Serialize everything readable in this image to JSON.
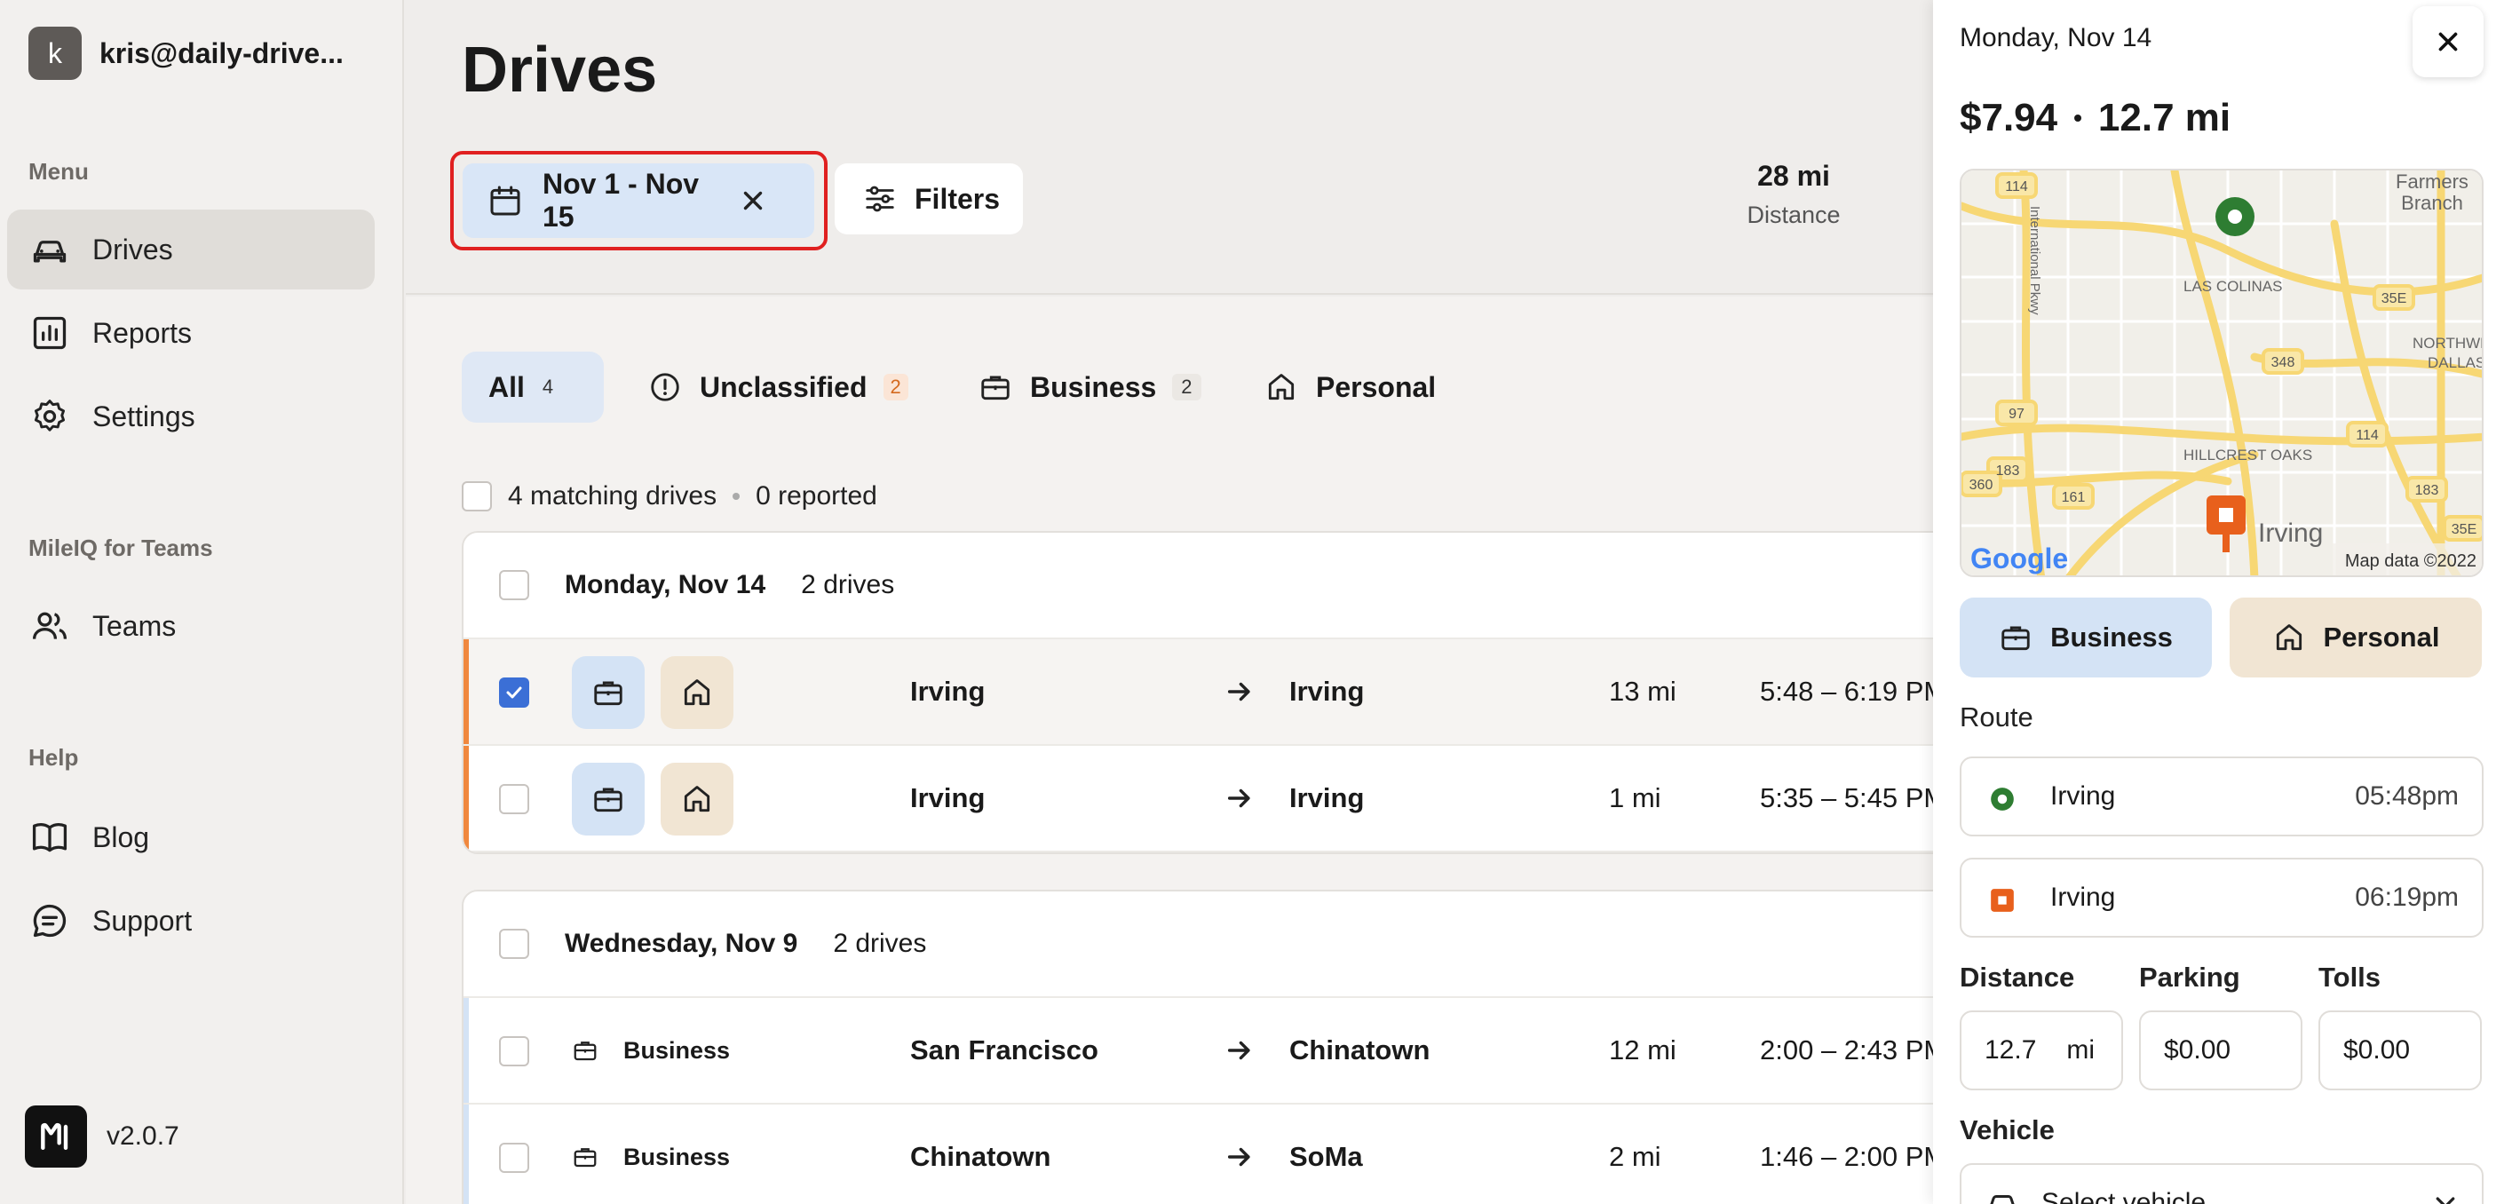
{
  "account": {
    "initial": "k",
    "email": "kris@daily-drive..."
  },
  "sidebar": {
    "menu_label": "Menu",
    "items": [
      {
        "label": "Drives",
        "icon": "car-icon",
        "active": true
      },
      {
        "label": "Reports",
        "icon": "chart-icon"
      },
      {
        "label": "Settings",
        "icon": "gear-icon"
      }
    ],
    "teams_label": "MileIQ for Teams",
    "teams_item": {
      "label": "Teams",
      "icon": "users-icon"
    },
    "help_label": "Help",
    "help_items": [
      {
        "label": "Blog",
        "icon": "book-icon"
      },
      {
        "label": "Support",
        "icon": "chat-icon"
      }
    ],
    "version": "v2.0.7"
  },
  "header": {
    "title": "Drives",
    "date_range": "Nov 1 - Nov 15",
    "filters_label": "Filters",
    "stat_value": "28 mi",
    "stat_label": "Distance"
  },
  "tabs": [
    {
      "label": "All",
      "count": "4"
    },
    {
      "label": "Unclassified",
      "count": "2"
    },
    {
      "label": "Business",
      "count": "2"
    },
    {
      "label": "Personal"
    }
  ],
  "summary": {
    "matching": "4 matching drives",
    "reported": "0 reported"
  },
  "groups": [
    {
      "date": "Monday, Nov 14",
      "count": "2 drives",
      "rows": [
        {
          "from": "Irving",
          "to": "Irving",
          "distance": "13 mi",
          "time": "5:48 – 6:19 PM",
          "checked": true
        },
        {
          "from": "Irving",
          "to": "Irving",
          "distance": "1 mi",
          "time": "5:35 – 5:45 PM",
          "checked": false
        }
      ]
    },
    {
      "date": "Wednesday, Nov 9",
      "count": "2 drives",
      "rows": [
        {
          "class_label": "Business",
          "from": "San Francisco",
          "to": "Chinatown",
          "distance": "12 mi",
          "time": "2:00 – 2:43 PM"
        },
        {
          "class_label": "Business",
          "from": "Chinatown",
          "to": "SoMa",
          "distance": "2 mi",
          "time": "1:46 – 2:00 PM"
        }
      ]
    }
  ],
  "panel": {
    "date": "Monday, Nov 14",
    "amount": "$7.94",
    "separator": "•",
    "distance": "12.7 mi",
    "map": {
      "labels": [
        "Farmers",
        "Branch",
        "LAS COLINAS",
        "NORTHWEST",
        "DALLAS",
        "HILLCREST OAKS",
        "Irving",
        "International Pkwy"
      ],
      "road_badges": [
        "114",
        "35E",
        "348",
        "97",
        "114",
        "183",
        "360",
        "161",
        "183",
        "35E"
      ],
      "google": "Google",
      "attribution": "Map data ©2022"
    },
    "business_label": "Business",
    "personal_label": "Personal",
    "route_label": "Route",
    "stops": [
      {
        "name": "Irving",
        "time": "05:48pm"
      },
      {
        "name": "Irving",
        "time": "06:19pm"
      }
    ],
    "distance_label": "Distance",
    "parking_label": "Parking",
    "tolls_label": "Tolls",
    "distance_value": "12.7",
    "distance_unit": "mi",
    "parking_value": "$0.00",
    "tolls_value": "$0.00",
    "vehicle_label": "Vehicle",
    "vehicle_placeholder": "Select vehicle"
  },
  "colors": {
    "accent_blue": "#3b6fd6",
    "unclassified_orange": "#f0883e",
    "business_blue": "#d4e3f5",
    "personal_tan": "#f1e5d3",
    "start_green": "#2e7d32",
    "end_orange": "#e8601c",
    "highlight_red": "#e02020"
  }
}
